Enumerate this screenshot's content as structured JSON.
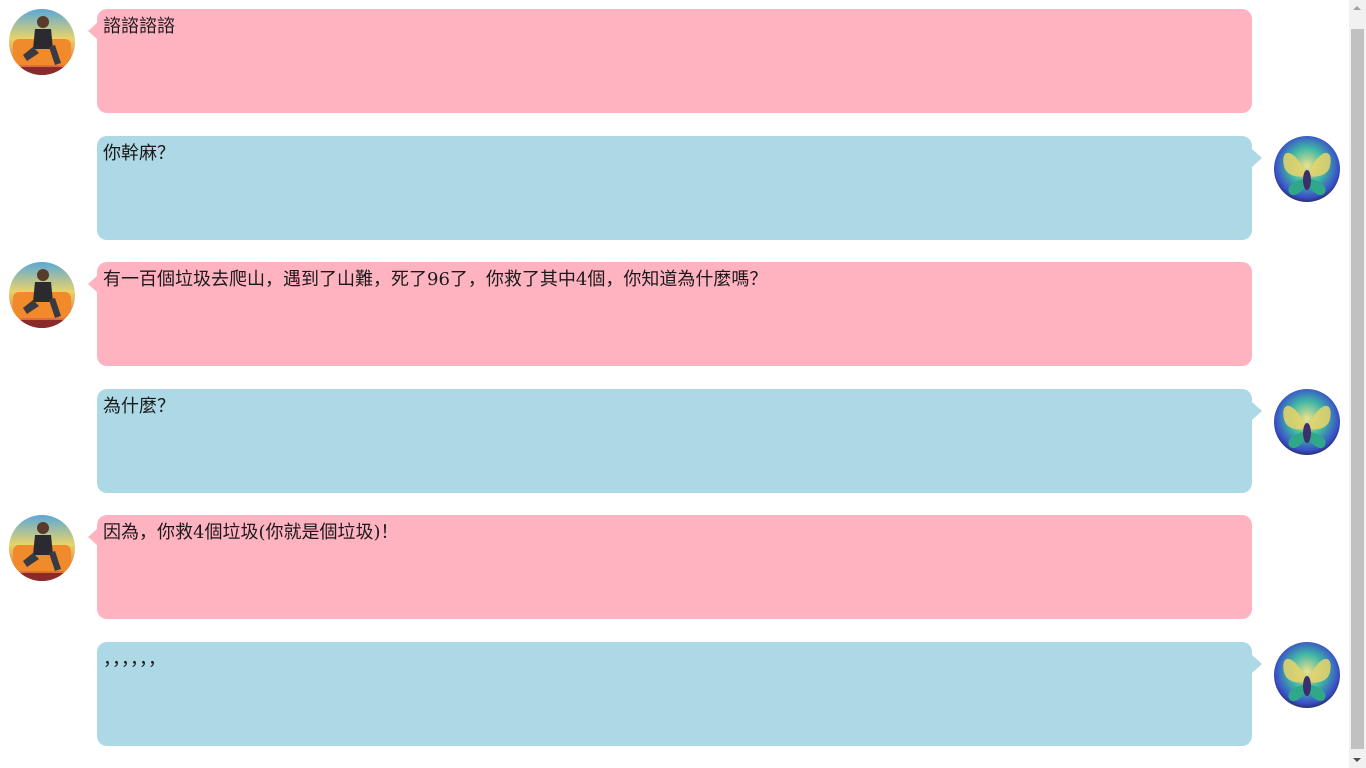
{
  "chat": {
    "messages": [
      {
        "side": "left",
        "text": "諮諮諮諮",
        "avatar": "person-on-sofa-avatar"
      },
      {
        "side": "right",
        "text": "你幹麻？",
        "avatar": "butterfly-wings-avatar"
      },
      {
        "side": "left",
        "text": "有一百個垃圾去爬山，遇到了山難，死了96了，你救了其中4個，你知道為什麼嗎？",
        "avatar": "person-on-sofa-avatar"
      },
      {
        "side": "right",
        "text": "為什麼？",
        "avatar": "butterfly-wings-avatar"
      },
      {
        "side": "left",
        "text": "因為，你救4個垃圾(你就是個垃圾)！",
        "avatar": "person-on-sofa-avatar"
      },
      {
        "side": "right",
        "text": "，，，，，，",
        "avatar": "butterfly-wings-avatar"
      }
    ]
  },
  "colors": {
    "left_bubble": "#ffb3c1",
    "right_bubble": "#add8e6",
    "scrollbar_track": "#f1f1f1",
    "scrollbar_thumb": "#c1c1c1"
  },
  "icons": {
    "scroll_up": "scroll-up-arrow-icon",
    "scroll_down": "scroll-down-arrow-icon"
  }
}
